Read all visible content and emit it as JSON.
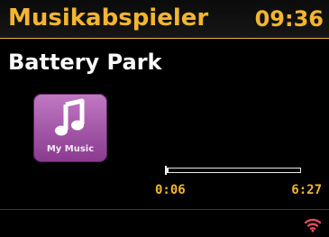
{
  "header": {
    "title": "Musikabspieler",
    "time": "09:36"
  },
  "now_playing": {
    "track_title": "Battery Park",
    "source_label": "My Music",
    "source_icon": "music-note-icon",
    "elapsed": "0:06",
    "total": "6:27",
    "progress_fraction": 0.016
  },
  "status": {
    "wifi_icon": "wifi-icon",
    "wifi_color": "#e14b5a"
  },
  "colors": {
    "accent": "#f3b530",
    "tile": "#a458a9"
  }
}
